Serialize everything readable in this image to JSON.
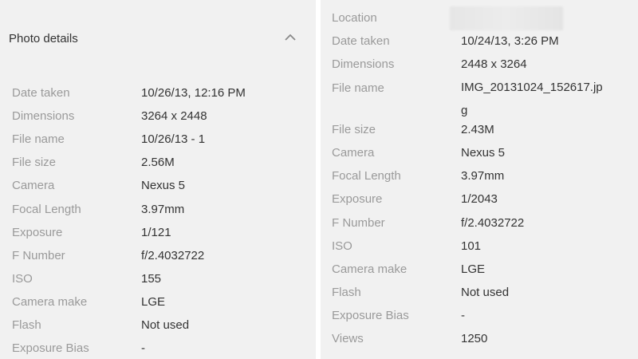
{
  "left_panel": {
    "title": "Photo details",
    "rows": [
      {
        "label": "Date taken",
        "value": "10/26/13, 12:16 PM"
      },
      {
        "label": "Dimensions",
        "value": "3264 x 2448"
      },
      {
        "label": "File name",
        "value": "10/26/13 - 1"
      },
      {
        "label": "File size",
        "value": "2.56M"
      },
      {
        "label": "Camera",
        "value": "Nexus 5"
      },
      {
        "label": "Focal Length",
        "value": "3.97mm"
      },
      {
        "label": "Exposure",
        "value": "1/121"
      },
      {
        "label": "F Number",
        "value": "f/2.4032722"
      },
      {
        "label": "ISO",
        "value": "155"
      },
      {
        "label": "Camera make",
        "value": "LGE"
      },
      {
        "label": "Flash",
        "value": "Not used"
      },
      {
        "label": "Exposure Bias",
        "value": "-"
      }
    ]
  },
  "right_panel": {
    "location_label": "Location",
    "rows": [
      {
        "label": "Date taken",
        "value": "10/24/13, 3:26 PM"
      },
      {
        "label": "Dimensions",
        "value": "2448 x 3264"
      },
      {
        "label": "File name",
        "value": "IMG_20131024_152617.jpg"
      },
      {
        "label": "File size",
        "value": "2.43M"
      },
      {
        "label": "Camera",
        "value": "Nexus 5"
      },
      {
        "label": "Focal Length",
        "value": "3.97mm"
      },
      {
        "label": "Exposure",
        "value": "1/2043"
      },
      {
        "label": "F Number",
        "value": "f/2.4032722"
      },
      {
        "label": "ISO",
        "value": "101"
      },
      {
        "label": "Camera make",
        "value": "LGE"
      },
      {
        "label": "Flash",
        "value": "Not used"
      },
      {
        "label": "Exposure Bias",
        "value": "-"
      },
      {
        "label": "Views",
        "value": "1250"
      }
    ]
  },
  "icons": {
    "collapse": "chevron-up-icon"
  }
}
